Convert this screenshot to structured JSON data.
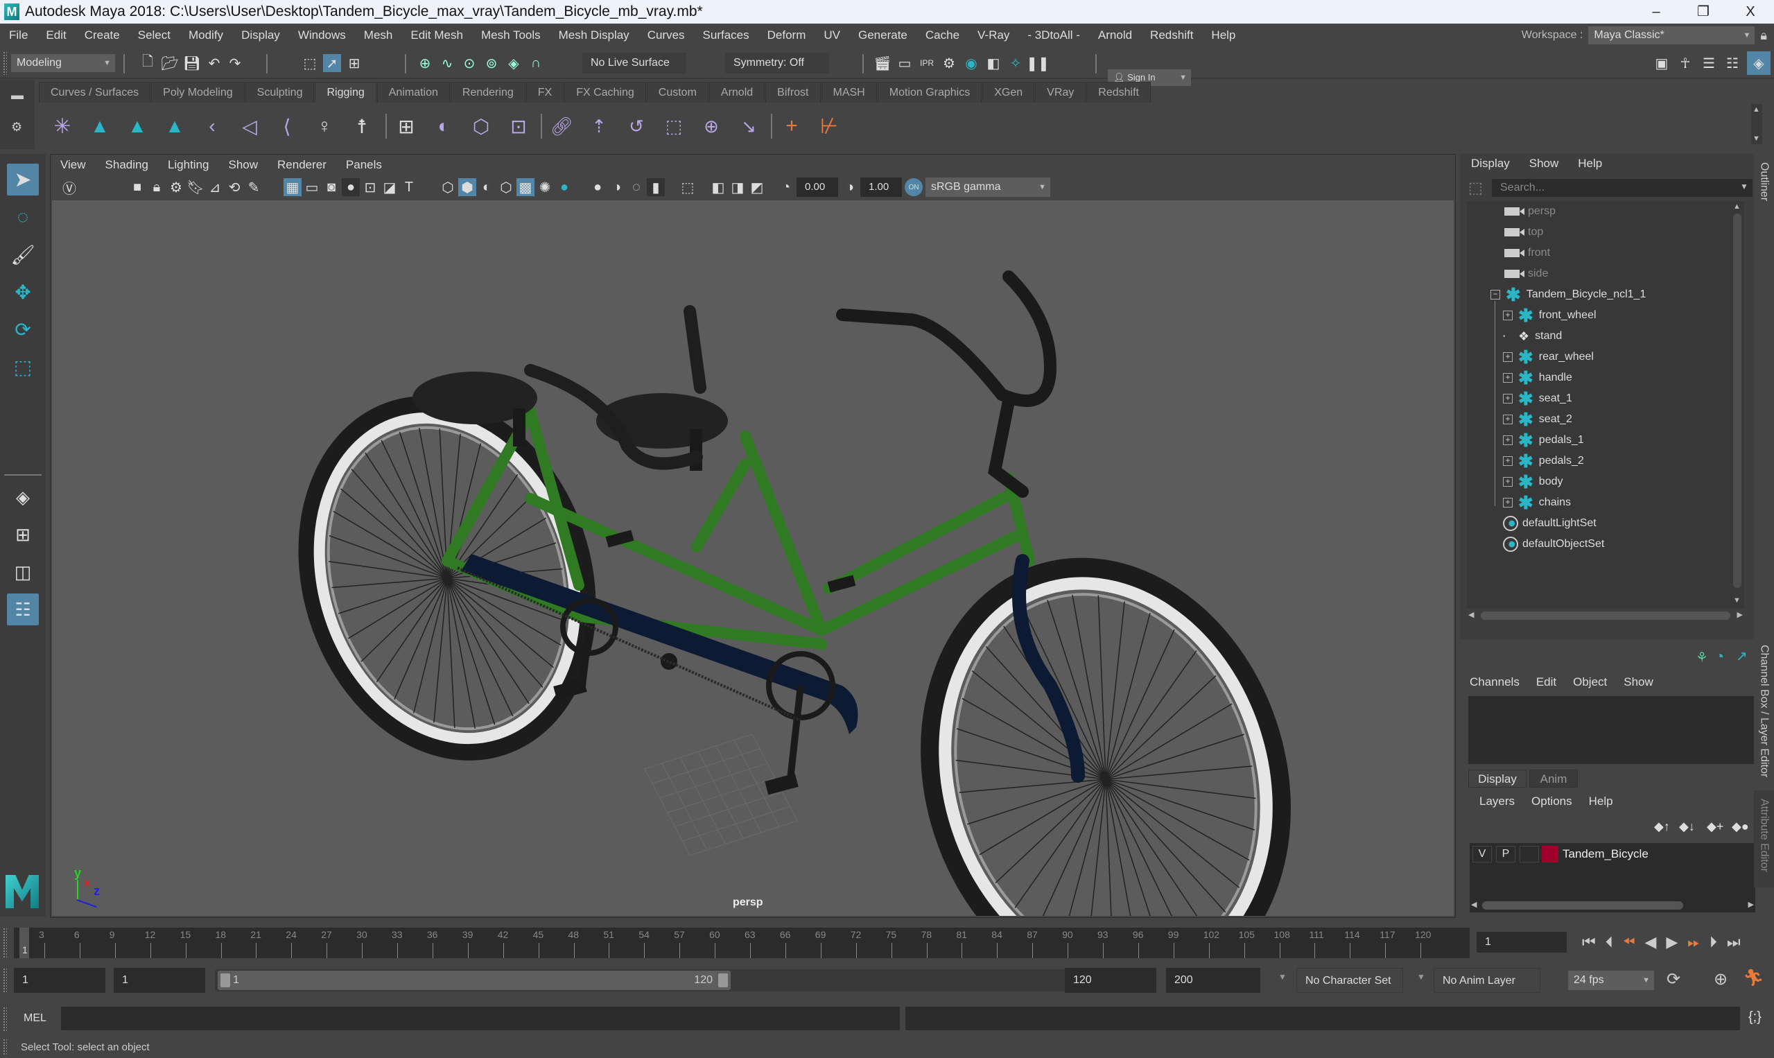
{
  "window": {
    "title": "Autodesk Maya 2018: C:\\Users\\User\\Desktop\\Tandem_Bicycle_max_vray\\Tandem_Bicycle_mb_vray.mb*",
    "logo": "M",
    "controls": {
      "minimize": "–",
      "restore": "❐",
      "close": "X"
    }
  },
  "menubar": {
    "items": [
      "File",
      "Edit",
      "Create",
      "Select",
      "Modify",
      "Display",
      "Windows",
      "Mesh",
      "Edit Mesh",
      "Mesh Tools",
      "Mesh Display",
      "Curves",
      "Surfaces",
      "Deform",
      "UV",
      "Generate",
      "Cache",
      "V-Ray",
      "- 3DtoAll -",
      "Arnold",
      "Redshift",
      "Help"
    ],
    "workspace_label": "Workspace :",
    "workspace_value": "Maya Classic*"
  },
  "statusline": {
    "mode": "Modeling",
    "live_surface": "No Live Surface",
    "symmetry": "Symmetry: Off",
    "sign_in": "Sign In"
  },
  "shelf": {
    "tabs": [
      "Curves / Surfaces",
      "Poly Modeling",
      "Sculpting",
      "Rigging",
      "Animation",
      "Rendering",
      "FX",
      "FX Caching",
      "Custom",
      "Arnold",
      "Bifrost",
      "MASH",
      "Motion Graphics",
      "XGen",
      "VRay",
      "Redshift"
    ],
    "active_tab": "Rigging"
  },
  "viewport": {
    "menus": [
      "View",
      "Shading",
      "Lighting",
      "Show",
      "Renderer",
      "Panels"
    ],
    "exposure": "0.00",
    "gamma": "1.00",
    "color_space": "sRGB gamma",
    "camera_label": "persp",
    "axis": {
      "x": "x",
      "y": "y",
      "z": "z"
    }
  },
  "outliner": {
    "menus": [
      "Display",
      "Show",
      "Help"
    ],
    "search_placeholder": "Search...",
    "cameras": [
      "persp",
      "top",
      "front",
      "side"
    ],
    "root": "Tandem_Bicycle_ncl1_1",
    "children": [
      {
        "name": "front_wheel",
        "type": "group"
      },
      {
        "name": "stand",
        "type": "mesh"
      },
      {
        "name": "rear_wheel",
        "type": "group"
      },
      {
        "name": "handle",
        "type": "group"
      },
      {
        "name": "seat_1",
        "type": "group"
      },
      {
        "name": "seat_2",
        "type": "group"
      },
      {
        "name": "pedals_1",
        "type": "group"
      },
      {
        "name": "pedals_2",
        "type": "group"
      },
      {
        "name": "body",
        "type": "group"
      },
      {
        "name": "chains",
        "type": "group"
      }
    ],
    "sets": [
      "defaultLightSet",
      "defaultObjectSet"
    ]
  },
  "channelbox": {
    "menus": [
      "Channels",
      "Edit",
      "Object",
      "Show"
    ]
  },
  "layers": {
    "tabs": [
      "Display",
      "Anim"
    ],
    "active_tab": "Display",
    "menus": [
      "Layers",
      "Options",
      "Help"
    ],
    "rows": [
      {
        "v": "V",
        "p": "P",
        "color": "#a0002a",
        "name": "Tandem_Bicycle"
      }
    ]
  },
  "side_tabs": {
    "outliner": "Outliner",
    "channel_box": "Channel Box / Layer Editor",
    "attribute_editor": "Attribute Editor"
  },
  "timeline": {
    "ticks": [
      "3",
      "6",
      "9",
      "12",
      "15",
      "18",
      "21",
      "24",
      "27",
      "30",
      "33",
      "36",
      "39",
      "42",
      "45",
      "48",
      "51",
      "54",
      "57",
      "60",
      "63",
      "66",
      "69",
      "72",
      "75",
      "78",
      "81",
      "84",
      "87",
      "90",
      "93",
      "96",
      "99",
      "102",
      "105",
      "108",
      "111",
      "114",
      "117",
      "120"
    ],
    "current_marker": "1",
    "current_frame": "1"
  },
  "range": {
    "start": "1",
    "playback_start": "1",
    "slider_start": "1",
    "slider_end": "120",
    "playback_end": "120",
    "end": "200",
    "character_set": "No Character Set",
    "anim_layer": "No Anim Layer",
    "fps": "24 fps"
  },
  "command": {
    "label": "MEL"
  },
  "help_line": "Select Tool: select an object"
}
